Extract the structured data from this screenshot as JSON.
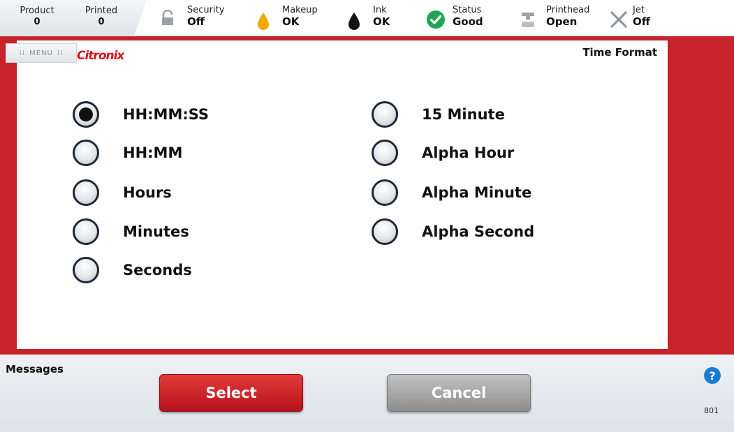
{
  "counters": [
    {
      "label": "Product",
      "value": "0"
    },
    {
      "label": "Printed",
      "value": "0"
    }
  ],
  "status": {
    "security": {
      "label": "Security",
      "value": "Off",
      "icon": "lock-icon"
    },
    "makeup": {
      "label": "Makeup",
      "value": "OK",
      "icon": "makeup-drop-icon",
      "color": "#f2a900"
    },
    "ink": {
      "label": "Ink",
      "value": "OK",
      "icon": "ink-drop-icon",
      "color": "#111111"
    },
    "status": {
      "label": "Status",
      "value": "Good",
      "icon": "check-circle-icon",
      "color": "#1ea651"
    },
    "printhead": {
      "label": "Printhead",
      "value": "Open",
      "icon": "printhead-icon"
    },
    "jet": {
      "label": "Jet",
      "value": "Off",
      "icon": "x-icon"
    }
  },
  "menu_label": "MENU",
  "logo": "Citronix",
  "screen_title": "Time Format",
  "options_left": [
    {
      "label": "HH:MM:SS",
      "checked": true
    },
    {
      "label": "HH:MM",
      "checked": false
    },
    {
      "label": "Hours",
      "checked": false
    },
    {
      "label": "Minutes",
      "checked": false
    },
    {
      "label": "Seconds",
      "checked": false
    }
  ],
  "options_right": [
    {
      "label": "15 Minute",
      "checked": false
    },
    {
      "label": "Alpha Hour",
      "checked": false
    },
    {
      "label": "Alpha Minute",
      "checked": false
    },
    {
      "label": "Alpha Second",
      "checked": false
    }
  ],
  "messages_label": "Messages",
  "buttons": {
    "select": "Select",
    "cancel": "Cancel"
  },
  "help": "?",
  "screen_code": "801",
  "colors": {
    "brand_red": "#c8222a",
    "help_blue": "#1c7ad3"
  }
}
